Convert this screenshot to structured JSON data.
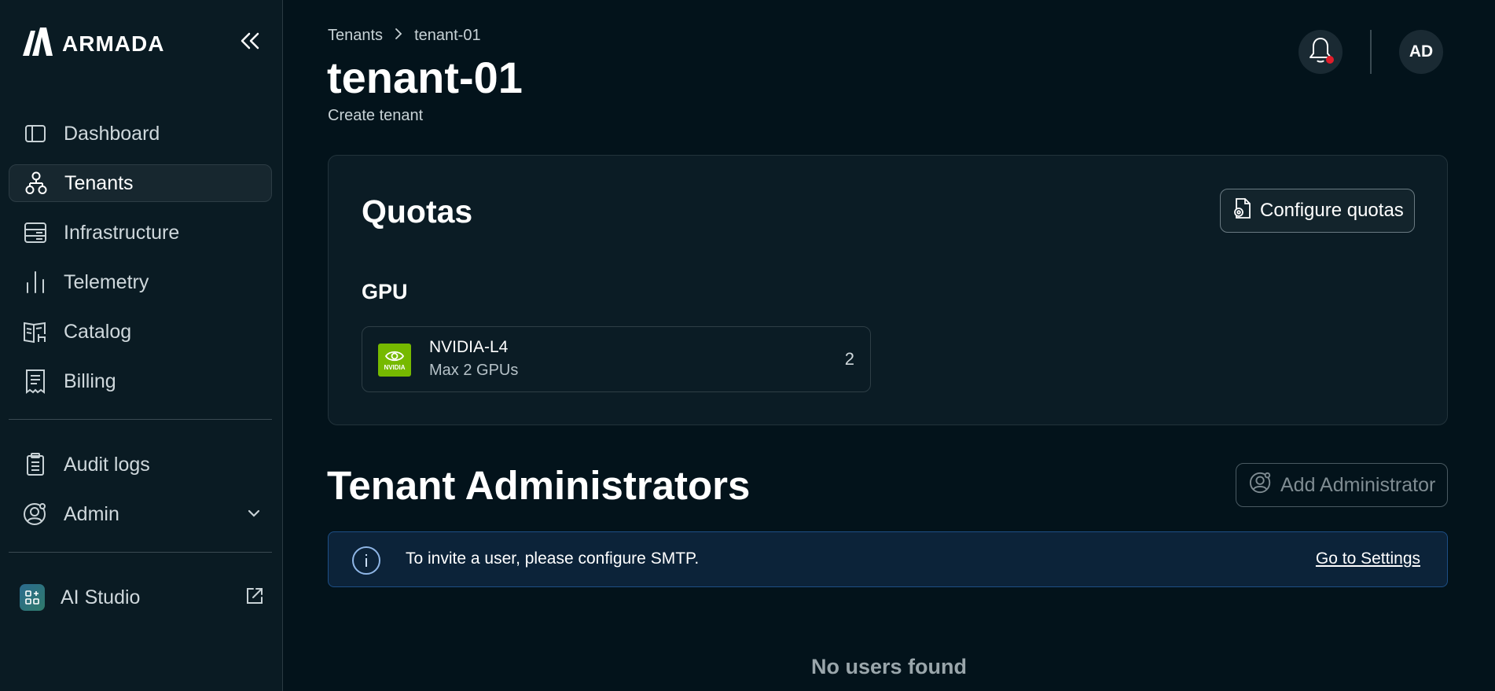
{
  "brand": {
    "name": "ARMADA"
  },
  "sidebar": {
    "items": [
      {
        "label": "Dashboard",
        "icon": "sidebar-panel-icon"
      },
      {
        "label": "Tenants",
        "icon": "tenants-hierarchy-icon",
        "active": true
      },
      {
        "label": "Infrastructure",
        "icon": "server-rack-icon"
      },
      {
        "label": "Telemetry",
        "icon": "bar-chart-icon"
      },
      {
        "label": "Catalog",
        "icon": "catalog-book-icon"
      },
      {
        "label": "Billing",
        "icon": "receipt-icon"
      }
    ],
    "secondary": [
      {
        "label": "Audit logs",
        "icon": "clipboard-icon"
      },
      {
        "label": "Admin",
        "icon": "user-gear-icon"
      }
    ],
    "external": {
      "label": "AI Studio",
      "icon": "ai-studio-icon"
    }
  },
  "breadcrumb": {
    "parent": "Tenants",
    "current": "tenant-01"
  },
  "page": {
    "title": "tenant-01",
    "subtitle": "Create tenant"
  },
  "quotas": {
    "title": "Quotas",
    "configure_label": "Configure quotas",
    "gpu_section": "GPU",
    "gpus": [
      {
        "name": "NVIDIA-L4",
        "description": "Max 2 GPUs",
        "count": "2",
        "logo_text": "NVIDIA"
      }
    ]
  },
  "administrators": {
    "title": "Tenant Administrators",
    "add_label": "Add Administrator",
    "banner_text": "To invite a user, please configure SMTP.",
    "banner_link": "Go to Settings",
    "empty_text": "No users found"
  },
  "user": {
    "initials": "AD"
  },
  "colors": {
    "background": "#03131b",
    "sidebar": "#0a1b23",
    "nvidia_green": "#76b900",
    "banner_bg": "#0c2339",
    "notification_dot": "#e11d2a"
  }
}
